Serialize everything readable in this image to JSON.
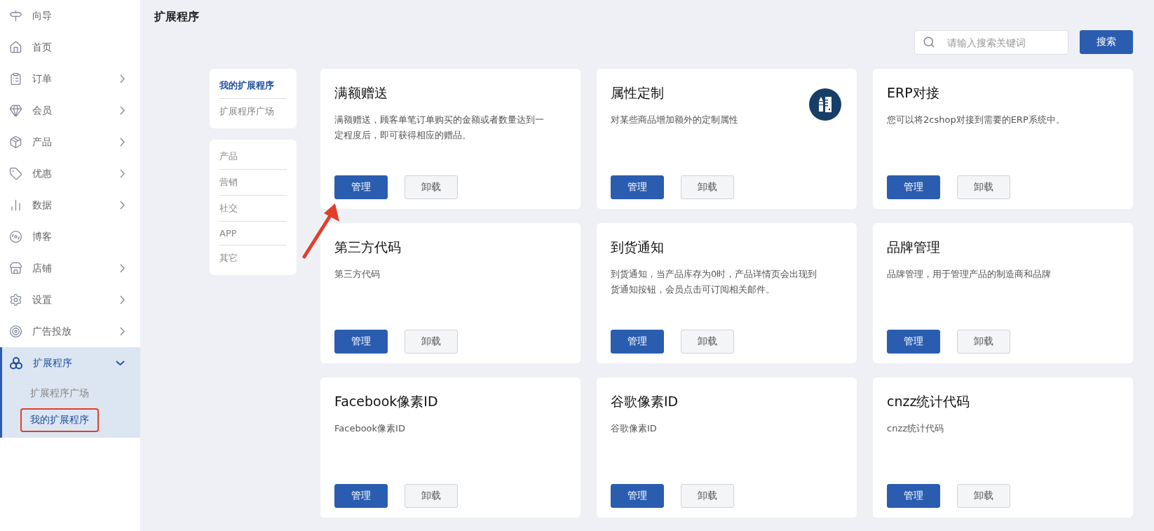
{
  "sidebar": {
    "items": [
      {
        "label": "向导",
        "kind": "link",
        "selected": false
      },
      {
        "label": "首页",
        "kind": "link",
        "selected": false
      },
      {
        "label": "订单",
        "kind": "collapsed",
        "selected": false
      },
      {
        "label": "会员",
        "kind": "collapsed",
        "selected": false
      },
      {
        "label": "产品",
        "kind": "collapsed",
        "selected": false
      },
      {
        "label": "优惠",
        "kind": "collapsed",
        "selected": false
      },
      {
        "label": "数据",
        "kind": "collapsed",
        "selected": false
      },
      {
        "label": "博客",
        "kind": "link",
        "selected": false
      },
      {
        "label": "店铺",
        "kind": "collapsed",
        "selected": false
      },
      {
        "label": "设置",
        "kind": "collapsed",
        "selected": false
      },
      {
        "label": "广告投放",
        "kind": "collapsed",
        "selected": false
      },
      {
        "label": "扩展程序",
        "kind": "expanded",
        "selected": true,
        "children": [
          {
            "label": "扩展程序广场",
            "selected": false,
            "highlighted": false
          },
          {
            "label": "我的扩展程序",
            "selected": true,
            "highlighted": true
          }
        ]
      }
    ]
  },
  "page": {
    "title": "扩展程序"
  },
  "search": {
    "placeholder": "请输入搜索关键词",
    "button": "搜索"
  },
  "filters": {
    "scope": [
      {
        "label": "我的扩展程序",
        "selected": true
      },
      {
        "label": "扩展程序广场",
        "selected": false
      }
    ],
    "categories": [
      {
        "label": "产品",
        "selected": false
      },
      {
        "label": "营销",
        "selected": false
      },
      {
        "label": "社交",
        "selected": false
      },
      {
        "label": "APP",
        "selected": false
      },
      {
        "label": "其它",
        "selected": false
      }
    ]
  },
  "cards": [
    {
      "title": "满额赠送",
      "description": "满额赠送，顾客单笔订单购买的金额或者数量达到一定程度后，即可获得相应的赠品。",
      "kind": "plain",
      "primary": "管理",
      "secondary": "卸载"
    },
    {
      "title": "属性定制",
      "description": "对某些商品增加额外的定制属性",
      "kind": "icon",
      "primary": "管理",
      "secondary": "卸载"
    },
    {
      "title": "ERP对接",
      "description": "您可以将2cshop对接到需要的ERP系统中。",
      "kind": "plain",
      "primary": "管理",
      "secondary": "卸载"
    },
    {
      "title": "第三方代码",
      "description": "第三方代码",
      "kind": "plain",
      "primary": "管理",
      "secondary": "卸载"
    },
    {
      "title": "到货通知",
      "description": "到货通知，当产品库存为0时，产品详情页会出现到货通知按钮，会员点击可订阅相关邮件。",
      "kind": "plain",
      "primary": "管理",
      "secondary": "卸载"
    },
    {
      "title": "品牌管理",
      "description": "品牌管理，用于管理产品的制造商和品牌",
      "kind": "plain",
      "primary": "管理",
      "secondary": "卸载"
    },
    {
      "title": "Facebook像素ID",
      "description": "Facebook像素ID",
      "kind": "plain",
      "primary": "管理",
      "secondary": "卸载"
    },
    {
      "title": "谷歌像素ID",
      "description": "谷歌像素ID",
      "kind": "plain",
      "primary": "管理",
      "secondary": "卸载"
    },
    {
      "title": "cnzz统计代码",
      "description": "cnzz统计代码",
      "kind": "plain",
      "primary": "管理",
      "secondary": "卸载"
    }
  ]
}
